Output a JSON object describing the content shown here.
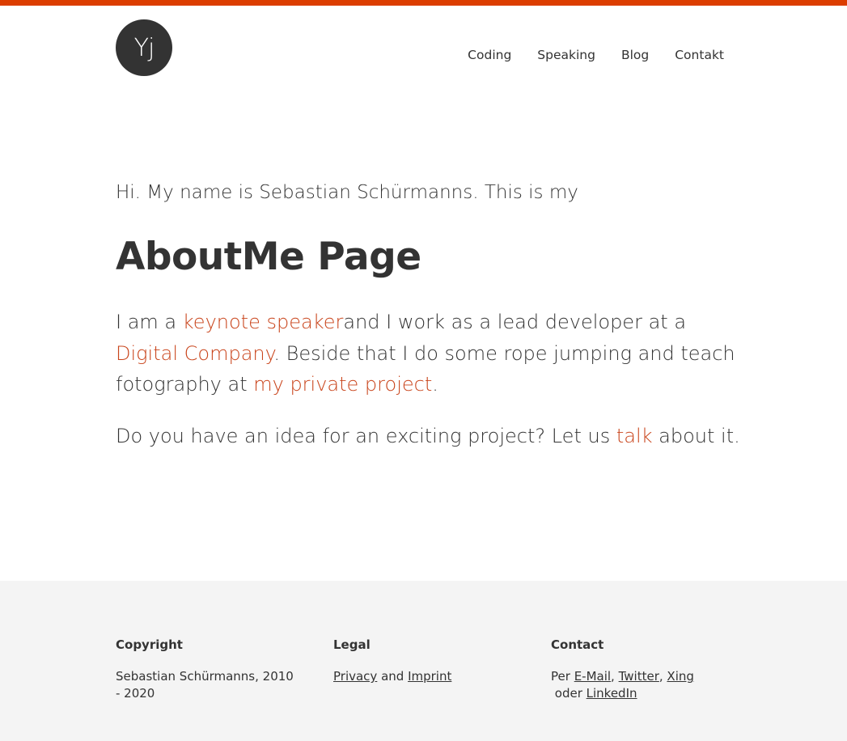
{
  "colors": {
    "accent": "#dc3d00",
    "link": "#c9441b",
    "text": "#333333",
    "footer_bg": "#f4f4f4"
  },
  "header": {
    "logo_text": "Yj",
    "nav": [
      "Coding",
      "Speaking",
      "Blog",
      "Contakt"
    ]
  },
  "main": {
    "intro": "Hi. My name is Sebastian Schürmanns. This is my",
    "title": "AboutMe Page",
    "p1": {
      "t1": "I am a ",
      "link1": "keynote speaker",
      "t2": "and I work as a lead developer at a ",
      "link2": "Digital Company",
      "t3": ". Beside that I do some rope jumping and teach fotography at ",
      "link3": "my private project",
      "t4": "."
    },
    "p2": {
      "t1": "Do you have an idea for an exciting project? Let us ",
      "link": "talk",
      "t2": " about it."
    }
  },
  "footer": {
    "copyright": {
      "heading": "Copyright",
      "text": "Sebastian Schürmanns, 2010 - 2020"
    },
    "legal": {
      "heading": "Legal",
      "privacy": "Privacy",
      "and": " and ",
      "imprint": "Imprint"
    },
    "contact": {
      "heading": "Contact",
      "per": "Per ",
      "email": "E-Mail",
      "sep1": ", ",
      "twitter": "Twitter",
      "sep2": ", ",
      "xing": "Xing",
      "oder": " oder ",
      "linkedin": "LinkedIn"
    }
  }
}
